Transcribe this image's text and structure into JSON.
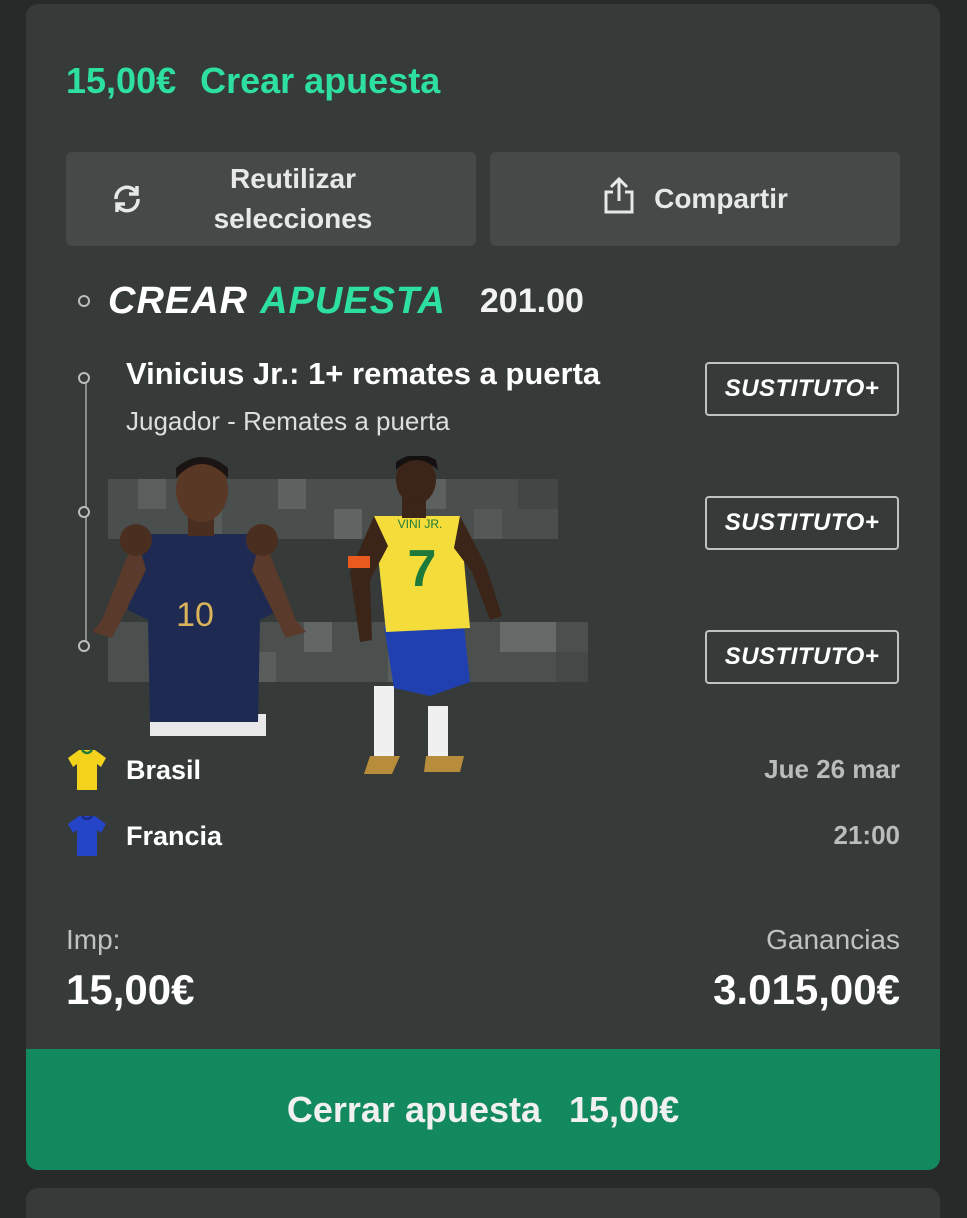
{
  "header": {
    "amount": "15,00€",
    "title": "Crear apuesta"
  },
  "actions": {
    "reuse_label_line1": "Reutilizar",
    "reuse_label_line2": "selecciones",
    "share_label": "Compartir"
  },
  "bet_builder": {
    "logo_word1": "CREAR",
    "logo_word2": "APUESTA",
    "odds": "201.00",
    "selections": [
      {
        "title": "Vinicius Jr.: 1+ remates a puerta",
        "subtitle": "Jugador - Remates a puerta",
        "substitute_label": "SUSTITUTO+"
      },
      {
        "substitute_label": "SUSTITUTO+"
      },
      {
        "substitute_label": "SUSTITUTO+"
      }
    ]
  },
  "match": {
    "home_team": "Brasil",
    "away_team": "Francia",
    "date": "Jue 26 mar",
    "time": "21:00",
    "home_color": "#f2d21b",
    "away_color": "#2545c8"
  },
  "players": [
    {
      "name": "mbappe",
      "shirt_number": "10",
      "shirt_color": "#1e2a52"
    },
    {
      "name": "vini-jr",
      "shirt_number": "7",
      "shirt_text": "VINI JR.",
      "shirt_color": "#f4dd3a"
    }
  ],
  "stake": {
    "label": "Imp:",
    "value": "15,00€"
  },
  "winnings": {
    "label": "Ganancias",
    "value": "3.015,00€"
  },
  "place_bet": {
    "label": "Cerrar apuesta",
    "amount": "15,00€"
  },
  "colors": {
    "accent": "#2ee0a0",
    "button_green": "#128a5e",
    "card_bg": "#363a39"
  }
}
